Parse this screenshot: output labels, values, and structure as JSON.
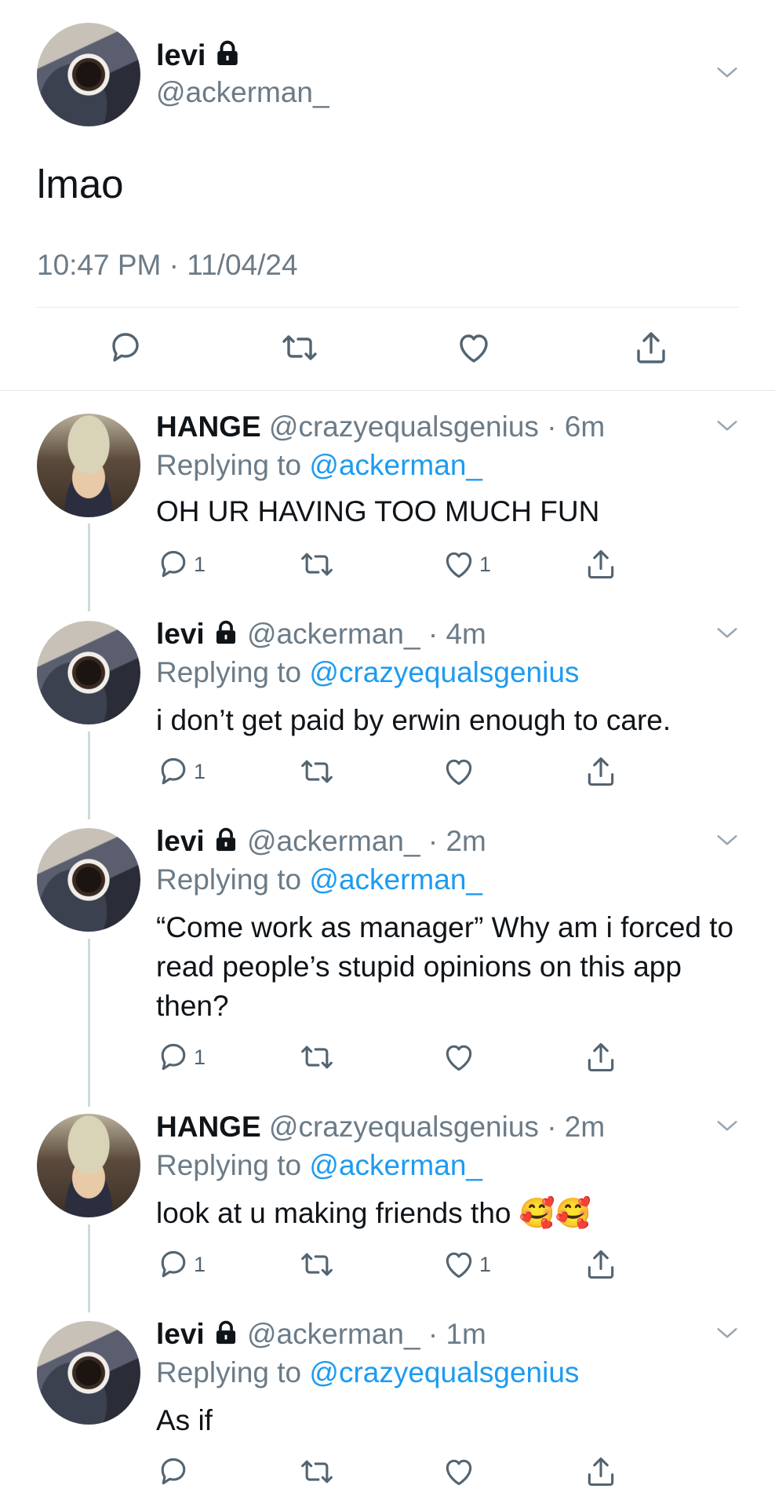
{
  "main_tweet": {
    "name": "levi",
    "handle": "@ackerman_",
    "text": "lmao",
    "meta": "10:47 PM · 11/04/24"
  },
  "replies": [
    {
      "name": "HANGE",
      "handle_time": "@crazyequalsgenius · 6m",
      "replying_label": "Replying to",
      "replying_to": "@ackerman_",
      "text": "OH UR HAVING TOO MUCH FUN",
      "reply_count": "1",
      "like_count": "1"
    },
    {
      "name": "levi",
      "handle_time": "@ackerman_ · 4m",
      "replying_label": "Replying to",
      "replying_to": "@crazyequalsgenius",
      "text": "i don’t get paid by erwin enough to care.",
      "reply_count": "1",
      "like_count": ""
    },
    {
      "name": "levi",
      "handle_time": "@ackerman_ · 2m",
      "replying_label": "Replying to",
      "replying_to": "@ackerman_",
      "text": "“Come work as manager” Why am i forced to read people’s stupid opinions on this app then?",
      "reply_count": "1",
      "like_count": ""
    },
    {
      "name": "HANGE",
      "handle_time": "@crazyequalsgenius · 2m",
      "replying_label": "Replying to",
      "replying_to": "@ackerman_",
      "text": "look at u making friends tho 🥰🥰",
      "reply_count": "1",
      "like_count": "1"
    },
    {
      "name": "levi",
      "handle_time": "@ackerman_ · 1m",
      "replying_label": "Replying to",
      "replying_to": "@crazyequalsgenius",
      "text": "As if",
      "reply_count": "",
      "like_count": ""
    }
  ],
  "icons": {
    "reply": "reply-icon",
    "retweet": "retweet-icon",
    "like": "like-icon",
    "share": "share-icon",
    "chevron": "chevron-down-icon",
    "lock": "lock-icon"
  },
  "colors": {
    "link": "#1d9bf0",
    "muted": "#6b7b87",
    "thread_line": "#cfd9de"
  }
}
